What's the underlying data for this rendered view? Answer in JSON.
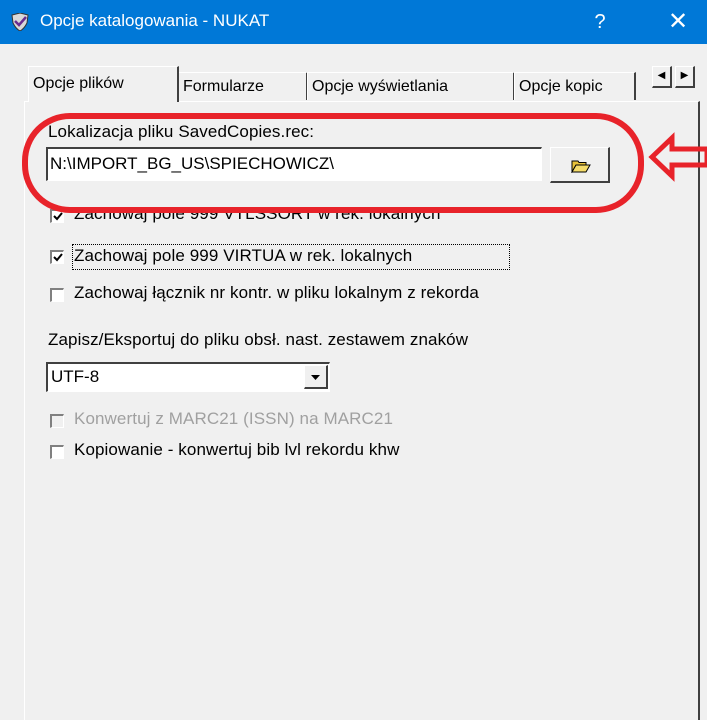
{
  "window": {
    "title": "Opcje katalogowania - NUKAT",
    "help_label": "?",
    "close_label": "✕"
  },
  "tabs": [
    {
      "label": "Opcje plików",
      "active": true
    },
    {
      "label": "Formularze",
      "active": false
    },
    {
      "label": "Opcje wyświetlania",
      "active": false
    },
    {
      "label": "Opcje kopic",
      "active": false
    }
  ],
  "tab_scroll": {
    "left": "◀",
    "right": "▶"
  },
  "file_location": {
    "label": "Lokalizacja pliku SavedCopies.rec:",
    "value": "N:\\IMPORT_BG_US\\SPIECHOWICZ\\"
  },
  "checkboxes": [
    {
      "label": "Zachowaj pole 999 VTLSSORT w rek. lokalnych",
      "checked": true,
      "enabled": true
    },
    {
      "label": "Zachowaj pole 999 VIRTUA w rek. lokalnych",
      "checked": true,
      "enabled": true
    },
    {
      "label": "Zachowaj łącznik nr kontr. w pliku lokalnym z rekorda",
      "checked": false,
      "enabled": true
    }
  ],
  "charset": {
    "label": "Zapisz/Eksportuj do pliku obsł. nast. zestawem znaków",
    "selected": "UTF-8"
  },
  "options2": [
    {
      "label": "Konwertuj z MARC21 (ISSN) na MARC21",
      "checked": false,
      "enabled": false
    },
    {
      "label": "Kopiowanie - konwertuj bib lvl rekordu khw",
      "checked": false,
      "enabled": true
    }
  ],
  "colors": {
    "titlebar": "#0078d7",
    "annotation": "#e8232a"
  }
}
